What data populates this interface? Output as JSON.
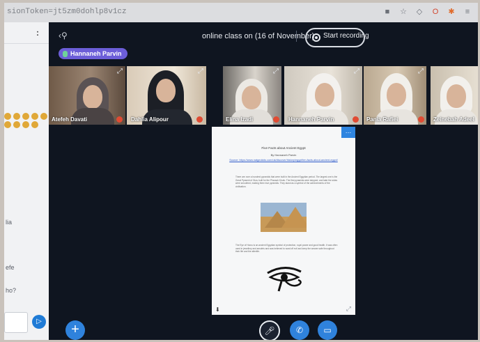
{
  "browser": {
    "url_fragment": "sionToken=jt5zm0dohlp8v1cz",
    "icons": [
      "camera-icon",
      "star-icon",
      "shield-icon",
      "opera-icon",
      "pin-icon",
      "puzzle-icon"
    ]
  },
  "chat": {
    "menu_label": ":",
    "fragments": [
      "lia",
      "efe",
      "ho?"
    ],
    "emoji_count": 10
  },
  "meeting": {
    "title": "online class on (16 of November)",
    "record_label": "Start recording",
    "presenter": "Hannaneh Parvin"
  },
  "tiles": [
    {
      "name": "Atefeh Davati"
    },
    {
      "name": "Dahlia Alipour"
    },
    {
      "name": "Elina Izadi"
    },
    {
      "name": "Hannaneh Parvin"
    },
    {
      "name": "Pania Rafiei"
    },
    {
      "name": "Zeinebah Adeel"
    }
  ],
  "slide": {
    "title": "Five Facts about Ancient Egypt",
    "author": "By Hannaneh Parvin",
    "source": "Source: https://www.natgeokids.com/uk/discover/history/egypt/ten-facts-about-ancient-egypt/",
    "para1": "There are over a hundred pyramids that were built in the Ancient Egyptian period. The largest one is the Great Pyramid of Giza, built for the Pharaoh Khufu. The first pyramids were stepped, and later the sides were smoothed, making them true pyramids. They stand as a symbol of the achievements of the civilisation.",
    "para2": "The Eye of Horus is an ancient Egyptian symbol of protection, royal power and good health. It was often used in jewellery and amulets and was believed to ward off evil and keep the wearer safe throughout their life and the afterlife."
  },
  "colors": {
    "accent": "#2f82dc",
    "presenter_badge": "#6c5ed8",
    "mic_muted": "#e04b33"
  }
}
